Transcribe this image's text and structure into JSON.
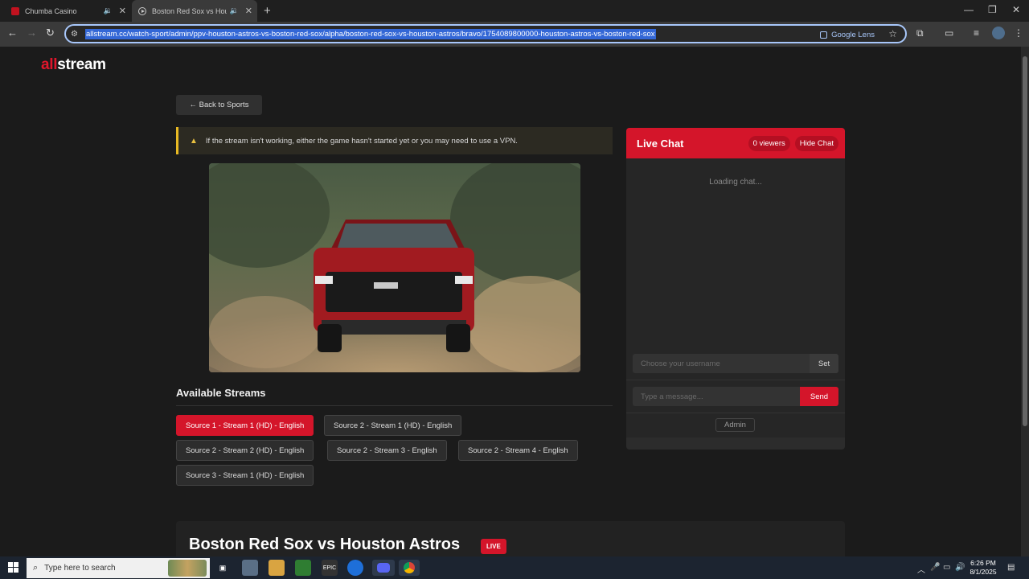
{
  "browser": {
    "tabs": [
      {
        "title": "Chumba Casino",
        "active": false
      },
      {
        "title": "Boston Red Sox vs Houston",
        "active": true
      }
    ],
    "url": "allstream.cc/watch-sport/admin/ppv-houston-astros-vs-boston-red-sox/alpha/boston-red-sox-vs-houston-astros/bravo/1754089800000-houston-astros-vs-boston-red-sox",
    "google_lens_label": "Google Lens"
  },
  "site": {
    "logo_accent": "all",
    "logo_rest": "stream",
    "accent_color": "#d4152a"
  },
  "page": {
    "back_label": "← Back to Sports",
    "notice_text": "If the stream isn't working, either the game hasn't started yet or you may need to use a VPN.",
    "streams_title": "Available Streams",
    "streams": [
      {
        "label": "Source 1 - Stream 1 (HD) - English",
        "active": true
      },
      {
        "label": "Source 2 - Stream 1 (HD) - English",
        "active": false
      },
      {
        "label": "Source 2 - Stream 2 (HD) - English",
        "active": false
      },
      {
        "label": "Source 2 - Stream 3 - English",
        "active": false
      },
      {
        "label": "Source 2 - Stream 4 - English",
        "active": false
      },
      {
        "label": "Source 3 - Stream 1 (HD) - English",
        "active": false
      }
    ],
    "game_title": "Boston Red Sox vs Houston Astros",
    "live_label": "LIVE"
  },
  "chat": {
    "title": "Live Chat",
    "viewers": "0 viewers",
    "hide_label": "Hide Chat",
    "loading_text": "Loading chat...",
    "username_placeholder": "Choose your username",
    "set_label": "Set",
    "message_placeholder": "Type a message...",
    "send_label": "Send",
    "admin_label": "Admin"
  },
  "taskbar": {
    "search_placeholder": "Type here to search",
    "time": "6:26 PM",
    "date": "8/1/2025"
  }
}
